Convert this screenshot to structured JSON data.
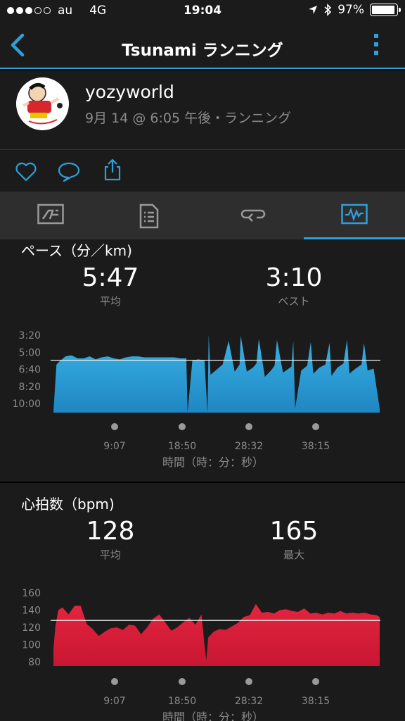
{
  "status_bar": {
    "carrier": "au",
    "network": "4G",
    "time": "19:04",
    "battery": "97%",
    "signal_bars": 3
  },
  "nav": {
    "title": "Tsunami ランニング"
  },
  "profile": {
    "username": "yozyworld",
    "meta": "9月 14 @ 6:05 午後・ランニング"
  },
  "pace": {
    "title": "ペース（分／km)",
    "avg_value": "5:47",
    "avg_label": "平均",
    "best_value": "3:10",
    "best_label": "ベスト"
  },
  "heart": {
    "title": "心拍数（bpm)",
    "avg_value": "128",
    "avg_label": "平均",
    "max_value": "165",
    "max_label": "最大"
  },
  "colors": {
    "accent": "#2f9fd8",
    "pace_fill": "#2ea8dc",
    "hr_fill": "#d11d3b"
  },
  "chart_data": [
    {
      "type": "area",
      "title": "ペース（分／km)",
      "xlabel": "時間（時：分：秒）",
      "x_ticks": [
        "9:07",
        "18:50",
        "28:32",
        "38:15"
      ],
      "y_ticks": [
        "3:20",
        "5:00",
        "6:40",
        "8:20",
        "10:00"
      ],
      "y_inverted": true,
      "average_line": "5:47",
      "series": [
        {
          "x_minutes": [
            0,
            0.5,
            1,
            2,
            3,
            4,
            5,
            6,
            7,
            8,
            9,
            10,
            11,
            12,
            13,
            14,
            15,
            16,
            17,
            18,
            19,
            20,
            21,
            22,
            22.2,
            23,
            24,
            25,
            25.5,
            25.7,
            26,
            27,
            28,
            29,
            30,
            30.8,
            31,
            32,
            33,
            33.6,
            34,
            35,
            36,
            36.6,
            37,
            38,
            39.4,
            39.7,
            40,
            41,
            42,
            42.6,
            43,
            44,
            45,
            45.7,
            46,
            47,
            48,
            48.6,
            49,
            50,
            51,
            51.4,
            52,
            53,
            54
          ],
          "pace_minutes_per_km": [
            10.8,
            6.2,
            5.9,
            5.4,
            5.3,
            5.6,
            5.6,
            5.4,
            5.7,
            5.5,
            5.4,
            5.6,
            5.7,
            5.5,
            5.4,
            5.4,
            5.5,
            5.5,
            5.5,
            5.5,
            5.5,
            5.5,
            5.6,
            5.6,
            11.0,
            5.8,
            5.7,
            5.8,
            11.0,
            3.3,
            7.2,
            6.7,
            6.2,
            3.9,
            6.9,
            6.2,
            3.4,
            6.9,
            6.5,
            6.1,
            3.7,
            7.4,
            6.8,
            6.3,
            3.8,
            7.0,
            6.4,
            3.9,
            10.5,
            6.8,
            6.3,
            4.0,
            7.1,
            6.5,
            6.2,
            4.1,
            7.3,
            6.5,
            6.1,
            3.8,
            7.1,
            6.6,
            6.2,
            4.1,
            6.8,
            6.6,
            10.5
          ]
        }
      ]
    },
    {
      "type": "area",
      "title": "心拍数（bpm)",
      "xlabel": "時間（時：分：秒）",
      "x_ticks": [
        "9:07",
        "18:50",
        "28:32",
        "38:15"
      ],
      "y_ticks": [
        160,
        140,
        120,
        100,
        80
      ],
      "ylim": [
        80,
        160
      ],
      "average_line": 128,
      "series": [
        {
          "x_minutes": [
            0,
            0.3,
            0.8,
            1.5,
            2.5,
            3.5,
            4.5,
            5.5,
            6.5,
            7.5,
            8.5,
            9.5,
            10.5,
            11.5,
            12.5,
            13.5,
            14.5,
            15.5,
            16.5,
            17.5,
            18.5,
            19.5,
            20.5,
            21.5,
            22.5,
            23.5,
            24.5,
            25.0,
            25.3,
            25.6,
            26.5,
            27.5,
            28.5,
            29.5,
            30.5,
            31.5,
            32.5,
            33.5,
            34.5,
            35.5,
            36.5,
            37.5,
            38.5,
            39.5,
            40.5,
            41.5,
            42.5,
            43.5,
            44.5,
            45.5,
            46.5,
            47.5,
            48.5,
            49.5,
            50.5,
            51.5,
            52.5,
            53.5,
            54
          ],
          "bpm": [
            95,
            120,
            140,
            143,
            135,
            145,
            145,
            124,
            118,
            110,
            115,
            119,
            120,
            117,
            123,
            122,
            112,
            120,
            130,
            135,
            126,
            116,
            120,
            126,
            131,
            123,
            135,
            100,
            82,
            108,
            115,
            118,
            117,
            121,
            125,
            132,
            134,
            147,
            137,
            138,
            136,
            140,
            141,
            139,
            138,
            142,
            136,
            137,
            135,
            137,
            136,
            139,
            136,
            137,
            136,
            137,
            135,
            134,
            132
          ]
        }
      ]
    }
  ]
}
